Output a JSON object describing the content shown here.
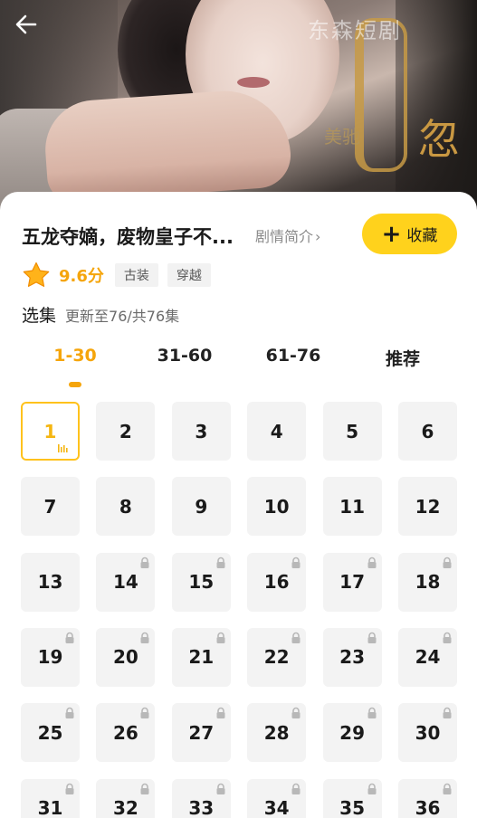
{
  "hero": {
    "watermark": "东森短剧",
    "calligraphy": "忽",
    "calligraphy_small": "美驰"
  },
  "drama": {
    "title": "五龙夺嫡，废物皇子不...",
    "synopsis_link": "剧情简介",
    "favorite_label": "收藏",
    "score": "9.6分",
    "tags": [
      "古装",
      "穿越"
    ]
  },
  "episodes": {
    "label": "选集",
    "update_text": "更新至76/共76集",
    "tabs": [
      "1-30",
      "31-60",
      "61-76",
      "推荐"
    ],
    "active_tab": 0,
    "active_episode": 1,
    "free_episodes": 13,
    "items": [
      "1",
      "2",
      "3",
      "4",
      "5",
      "6",
      "7",
      "8",
      "9",
      "10",
      "11",
      "12",
      "13",
      "14",
      "15",
      "16",
      "17",
      "18",
      "19",
      "20",
      "21",
      "22",
      "23",
      "24",
      "25",
      "26",
      "27",
      "28",
      "29",
      "30",
      "31",
      "32",
      "33",
      "34",
      "35",
      "36"
    ]
  },
  "colors": {
    "accent": "#f5a50b",
    "button": "#ffd21c",
    "cell": "#f3f3f3"
  },
  "icons": {
    "back": "arrow-left-icon",
    "star": "star-icon",
    "lock": "lock-icon",
    "playing": "playing-bars-icon",
    "add": "plus-icon"
  }
}
